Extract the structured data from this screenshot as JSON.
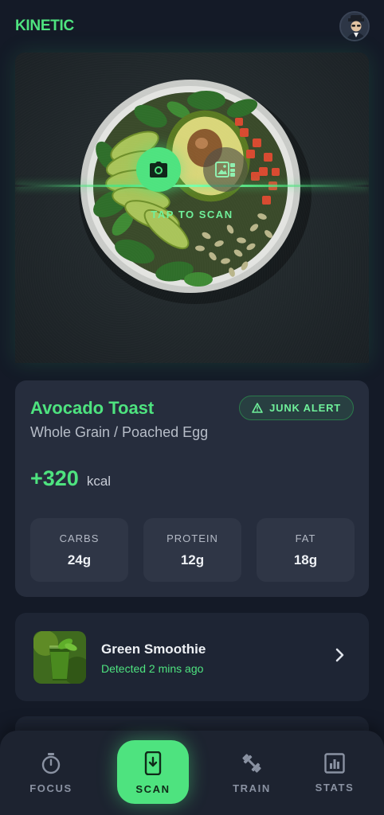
{
  "header": {
    "brand": "KINETIC",
    "avatar_icon": "user-avatar"
  },
  "scanner": {
    "hint": "TAP TO SCAN",
    "camera_icon": "camera-icon",
    "gallery_icon": "gallery-icon",
    "accent": "#4ee37f"
  },
  "result": {
    "name": "Avocado Toast",
    "subtitle": "Whole Grain / Poached Egg",
    "alert_label": "JUNK ALERT",
    "alert_icon": "warning-icon",
    "calories_value": "+320",
    "calories_unit": "kcal",
    "macros": [
      {
        "label": "CARBS",
        "value": "24g"
      },
      {
        "label": "PROTEIN",
        "value": "12g"
      },
      {
        "label": "FAT",
        "value": "18g"
      }
    ]
  },
  "history": {
    "items": [
      {
        "title": "Green Smoothie",
        "meta": "Detected 2 mins ago"
      }
    ]
  },
  "nav": {
    "items": [
      {
        "label": "FOCUS",
        "icon": "stopwatch-icon"
      },
      {
        "label": "SCAN",
        "icon": "phone-scan-icon",
        "active": true
      },
      {
        "label": "TRAIN",
        "icon": "dumbbell-icon"
      },
      {
        "label": "STATS",
        "icon": "bar-chart-icon"
      }
    ]
  }
}
